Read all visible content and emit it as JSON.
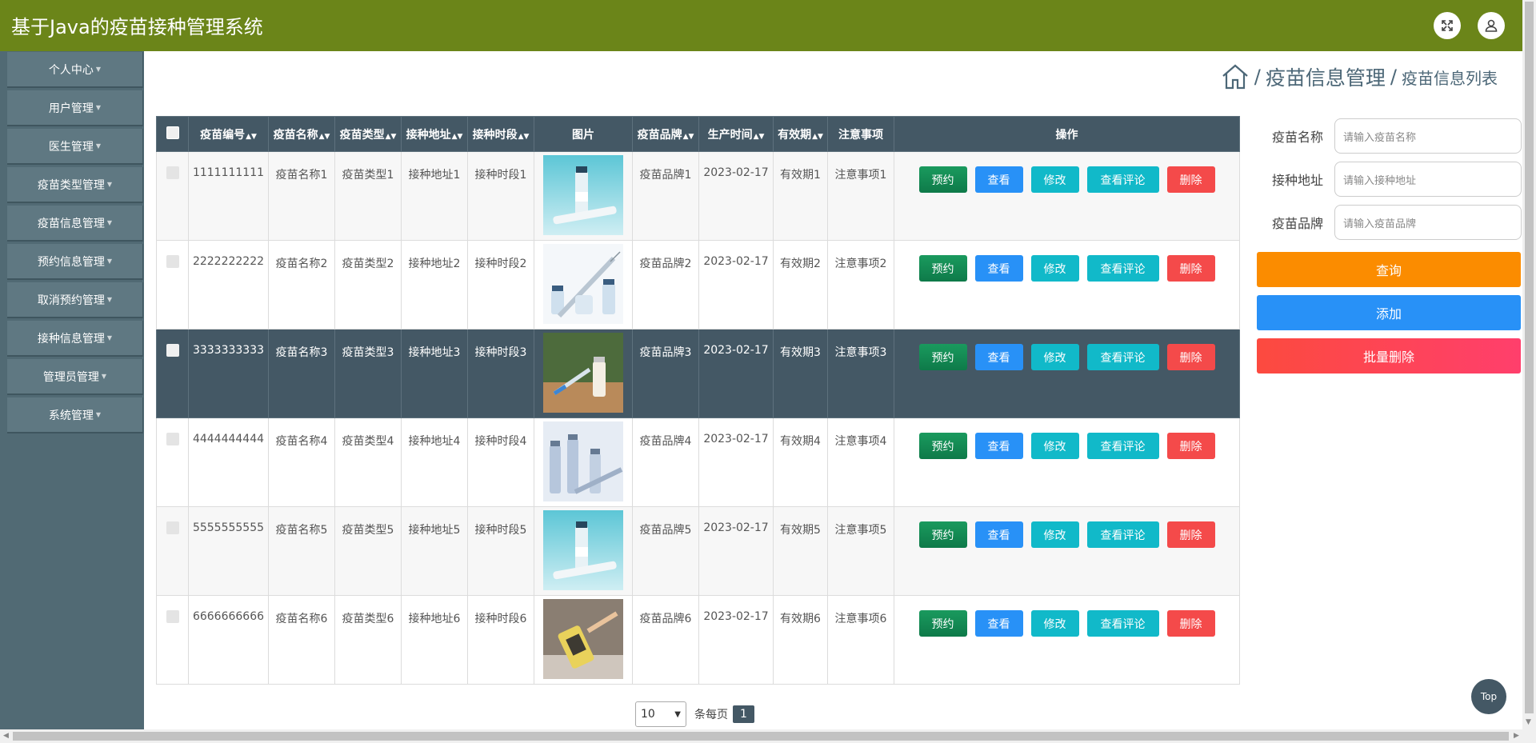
{
  "header": {
    "title": "基于Java的疫苗接种管理系统"
  },
  "sidebar": {
    "items": [
      {
        "label": "个人中心"
      },
      {
        "label": "用户管理"
      },
      {
        "label": "医生管理"
      },
      {
        "label": "疫苗类型管理"
      },
      {
        "label": "疫苗信息管理"
      },
      {
        "label": "预约信息管理"
      },
      {
        "label": "取消预约管理"
      },
      {
        "label": "接种信息管理"
      },
      {
        "label": "管理员管理"
      },
      {
        "label": "系统管理"
      }
    ]
  },
  "breadcrumb": {
    "section": "疫苗信息管理",
    "page": "疫苗信息列表"
  },
  "table": {
    "headers": [
      "疫苗编号",
      "疫苗名称",
      "疫苗类型",
      "接种地址",
      "接种时段",
      "图片",
      "疫苗品牌",
      "生产时间",
      "有效期",
      "注意事项",
      "操作"
    ],
    "rows": [
      {
        "id": "1111111111",
        "name": "疫苗名称1",
        "type": "疫苗类型1",
        "addr": "接种地址1",
        "slot": "接种时段1",
        "brand": "疫苗品牌1",
        "date": "2023-02-17",
        "valid": "有效期1",
        "note": "注意事项1"
      },
      {
        "id": "2222222222",
        "name": "疫苗名称2",
        "type": "疫苗类型2",
        "addr": "接种地址2",
        "slot": "接种时段2",
        "brand": "疫苗品牌2",
        "date": "2023-02-17",
        "valid": "有效期2",
        "note": "注意事项2"
      },
      {
        "id": "3333333333",
        "name": "疫苗名称3",
        "type": "疫苗类型3",
        "addr": "接种地址3",
        "slot": "接种时段3",
        "brand": "疫苗品牌3",
        "date": "2023-02-17",
        "valid": "有效期3",
        "note": "注意事项3"
      },
      {
        "id": "4444444444",
        "name": "疫苗名称4",
        "type": "疫苗类型4",
        "addr": "接种地址4",
        "slot": "接种时段4",
        "brand": "疫苗品牌4",
        "date": "2023-02-17",
        "valid": "有效期4",
        "note": "注意事项4"
      },
      {
        "id": "5555555555",
        "name": "疫苗名称5",
        "type": "疫苗类型5",
        "addr": "接种地址5",
        "slot": "接种时段5",
        "brand": "疫苗品牌5",
        "date": "2023-02-17",
        "valid": "有效期5",
        "note": "注意事项5"
      },
      {
        "id": "6666666666",
        "name": "疫苗名称6",
        "type": "疫苗类型6",
        "addr": "接种地址6",
        "slot": "接种时段6",
        "brand": "疫苗品牌6",
        "date": "2023-02-17",
        "valid": "有效期6",
        "note": "注意事项6"
      }
    ],
    "actions": {
      "book": "预约",
      "view": "查看",
      "edit": "修改",
      "review": "查看评论",
      "delete": "删除"
    }
  },
  "search": {
    "name_label": "疫苗名称",
    "name_placeholder": "请输入疫苗名称",
    "addr_label": "接种地址",
    "addr_placeholder": "请输入接种地址",
    "brand_label": "疫苗品牌",
    "brand_placeholder": "请输入疫苗品牌",
    "query_label": "查询",
    "add_label": "添加",
    "batch_delete_label": "批量删除"
  },
  "pager": {
    "page_size": "10",
    "per_page_label": "条每页",
    "current_page": "1"
  },
  "top_label": "Top",
  "colors": {
    "header": "#6b8519",
    "sidebar": "#516a74",
    "table_head": "#445865",
    "query": "#fb8c00",
    "add": "#2891f7",
    "batch_delete": "#fc4a3f"
  }
}
